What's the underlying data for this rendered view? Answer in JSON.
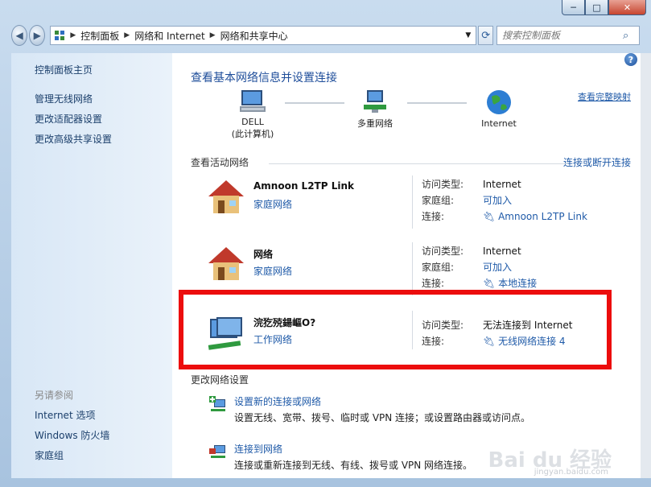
{
  "window": {
    "caption": {
      "min": "─",
      "max": "□",
      "close": "✕"
    }
  },
  "addressbar": {
    "crumbs": [
      "控制面板",
      "网络和 Internet",
      "网络和共享中心"
    ],
    "search_placeholder": "搜索控制面板"
  },
  "sidebar": {
    "items": [
      "控制面板主页",
      "管理无线网络",
      "更改适配器设置",
      "更改高级共享设置"
    ],
    "see_also_title": "另请参阅",
    "see_also": [
      "Internet 选项",
      "Windows 防火墙",
      "家庭组"
    ]
  },
  "main": {
    "title": "查看基本网络信息并设置连接",
    "full_map_link": "查看完整映射",
    "map_nodes": {
      "computer_line1": "DELL",
      "computer_line2": "(此计算机)",
      "network": "多重网络",
      "internet": "Internet"
    },
    "active_label": "查看活动网络",
    "connect_link": "连接或断开连接",
    "networks": [
      {
        "name": "Amnoon L2TP Link",
        "type": "家庭网络",
        "rows": [
          {
            "k": "访问类型:",
            "v": "Internet",
            "link": false
          },
          {
            "k": "家庭组:",
            "v": "可加入",
            "link": true
          },
          {
            "k": "连接:",
            "v": "Amnoon L2TP Link",
            "link": true
          }
        ]
      },
      {
        "name": "网络",
        "type": "家庭网络",
        "rows": [
          {
            "k": "访问类型:",
            "v": "Internet",
            "link": false
          },
          {
            "k": "家庭组:",
            "v": "可加入",
            "link": true
          },
          {
            "k": "连接:",
            "v": "本地连接",
            "link": true
          }
        ]
      },
      {
        "name": "浣犵殑鍚嶇О?",
        "type": "工作网络",
        "rows": [
          {
            "k": "访问类型:",
            "v": "无法连接到 Internet",
            "link": false
          },
          {
            "k": "连接:",
            "v": "无线网络连接 4",
            "link": true
          }
        ]
      }
    ],
    "change_label": "更改网络设置",
    "tasks": [
      {
        "link": "设置新的连接或网络",
        "desc": "设置无线、宽带、拨号、临时或 VPN 连接；或设置路由器或访问点。"
      },
      {
        "link": "连接到网络",
        "desc": "连接或重新连接到无线、有线、拨号或 VPN 网络连接。"
      }
    ],
    "watermark": "Bai du 经验",
    "watermark_url": "jingyan.baidu.com"
  }
}
